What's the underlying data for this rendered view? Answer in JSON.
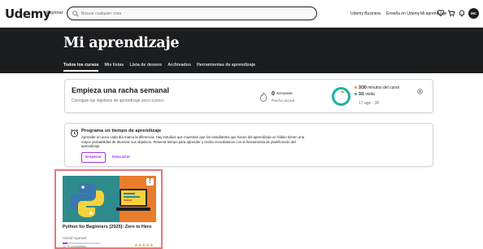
{
  "header": {
    "logo": "Udemy",
    "explore_label": "Explorar",
    "search_placeholder": "Buscar cualquier cosa",
    "nav": {
      "business": "Udemy Business",
      "teach": "Enseña en Udemy",
      "my_learning": "Mi aprendizaje"
    },
    "avatar_initials": "MC"
  },
  "hero": {
    "title": "Mi aprendizaje",
    "tabs": [
      {
        "label": "Todos los cursos",
        "active": true
      },
      {
        "label": "Mis listas",
        "active": false
      },
      {
        "label": "Lista de deseos",
        "active": false
      },
      {
        "label": "Archivados",
        "active": false
      },
      {
        "label": "Herramientas de aprendizaje",
        "active": false
      }
    ]
  },
  "streak": {
    "title": "Empieza una racha semanal",
    "subtitle": "Consigue tus objetivos de aprendizaje poco a poco.",
    "weeks_value": "0",
    "weeks_label": "semanas",
    "weeks_sub": "Racha actual",
    "stat_minutes": "3/30",
    "stat_minutes_label": "minutos del curso",
    "stat_visits": "3/1",
    "stat_visits_label": "visita",
    "date_range": "17 ago - 30",
    "colors": {
      "minutes": "#f69c08",
      "visits": "#1eb2a6"
    }
  },
  "schedule": {
    "title": "Programa un tiempo de aprendizaje",
    "body": "Aprender un poco cada día marca la diferencia. Hay estudios que muestran que los estudiantes que hacen del aprendizaje un hábito tienen una mayor probabilidad de alcanzar sus objetivos. Reserva tiempo para aprender y recibe recordatorios con la herramienta de planificación del aprendizaje.",
    "primary_button": "Empezar",
    "secondary_button": "Descartar"
  },
  "course": {
    "title": "Python for Beginners [2025]: Zero to Hero",
    "author": "Hamid Agarwal",
    "progress_percent": 12,
    "progress_text": "12 % completado",
    "rating_stars": "★★★★★"
  }
}
